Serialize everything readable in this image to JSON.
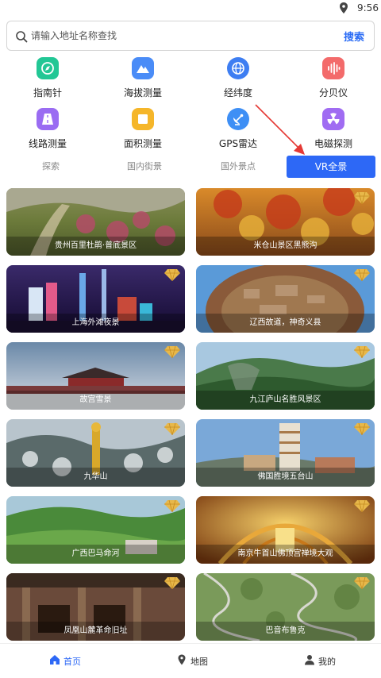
{
  "status_bar": {
    "time": "9:56",
    "location_icon": "location-pin-icon"
  },
  "search": {
    "placeholder": "请输入地址名称查找",
    "button_label": "搜索",
    "icon": "search-icon"
  },
  "tools": [
    {
      "label": "指南针",
      "icon": "compass-icon",
      "color": "#22c795"
    },
    {
      "label": "海拔测量",
      "icon": "mountain-icon",
      "color": "#4a8cf7"
    },
    {
      "label": "经纬度",
      "icon": "globe-icon",
      "color": "#3e7ef2"
    },
    {
      "label": "分贝仪",
      "icon": "sound-wave-icon",
      "color": "#f36b6b"
    },
    {
      "label": "线路测量",
      "icon": "road-icon",
      "color": "#9a6cf2"
    },
    {
      "label": "面积测量",
      "icon": "square-area-icon",
      "color": "#f5b62a"
    },
    {
      "label": "GPS雷达",
      "icon": "satellite-dish-icon",
      "color": "#3e8ff5"
    },
    {
      "label": "电磁探测",
      "icon": "radiation-icon",
      "color": "#a06cf2"
    }
  ],
  "tabs": [
    {
      "label": "探索",
      "active": false
    },
    {
      "label": "国内街景",
      "active": false
    },
    {
      "label": "国外景点",
      "active": false
    },
    {
      "label": "VR全景",
      "active": true
    }
  ],
  "scenes": [
    {
      "title": "贵州百里杜鹃·普底景区",
      "premium": false
    },
    {
      "title": "米仓山景区黑熊沟",
      "premium": true
    },
    {
      "title": "上海外滩夜景",
      "premium": true
    },
    {
      "title": "辽西故道，神奇义县",
      "premium": true
    },
    {
      "title": "故宫雪景",
      "premium": true
    },
    {
      "title": "九江庐山名胜风景区",
      "premium": true
    },
    {
      "title": "九华山",
      "premium": true
    },
    {
      "title": "佛国胜境五台山",
      "premium": true
    },
    {
      "title": "广西巴马命河",
      "premium": true
    },
    {
      "title": "南京牛首山佛顶宫禅境大观",
      "premium": true
    },
    {
      "title": "凤凰山麓革命旧址",
      "premium": true
    },
    {
      "title": "巴音布鲁克",
      "premium": true
    }
  ],
  "bottom_nav": [
    {
      "label": "首页",
      "icon": "home-icon",
      "active": true
    },
    {
      "label": "地图",
      "icon": "map-pin-icon",
      "active": false
    },
    {
      "label": "我的",
      "icon": "user-icon",
      "active": false
    }
  ],
  "colors": {
    "accent": "#2d68f6",
    "annotation": "#e53935"
  }
}
